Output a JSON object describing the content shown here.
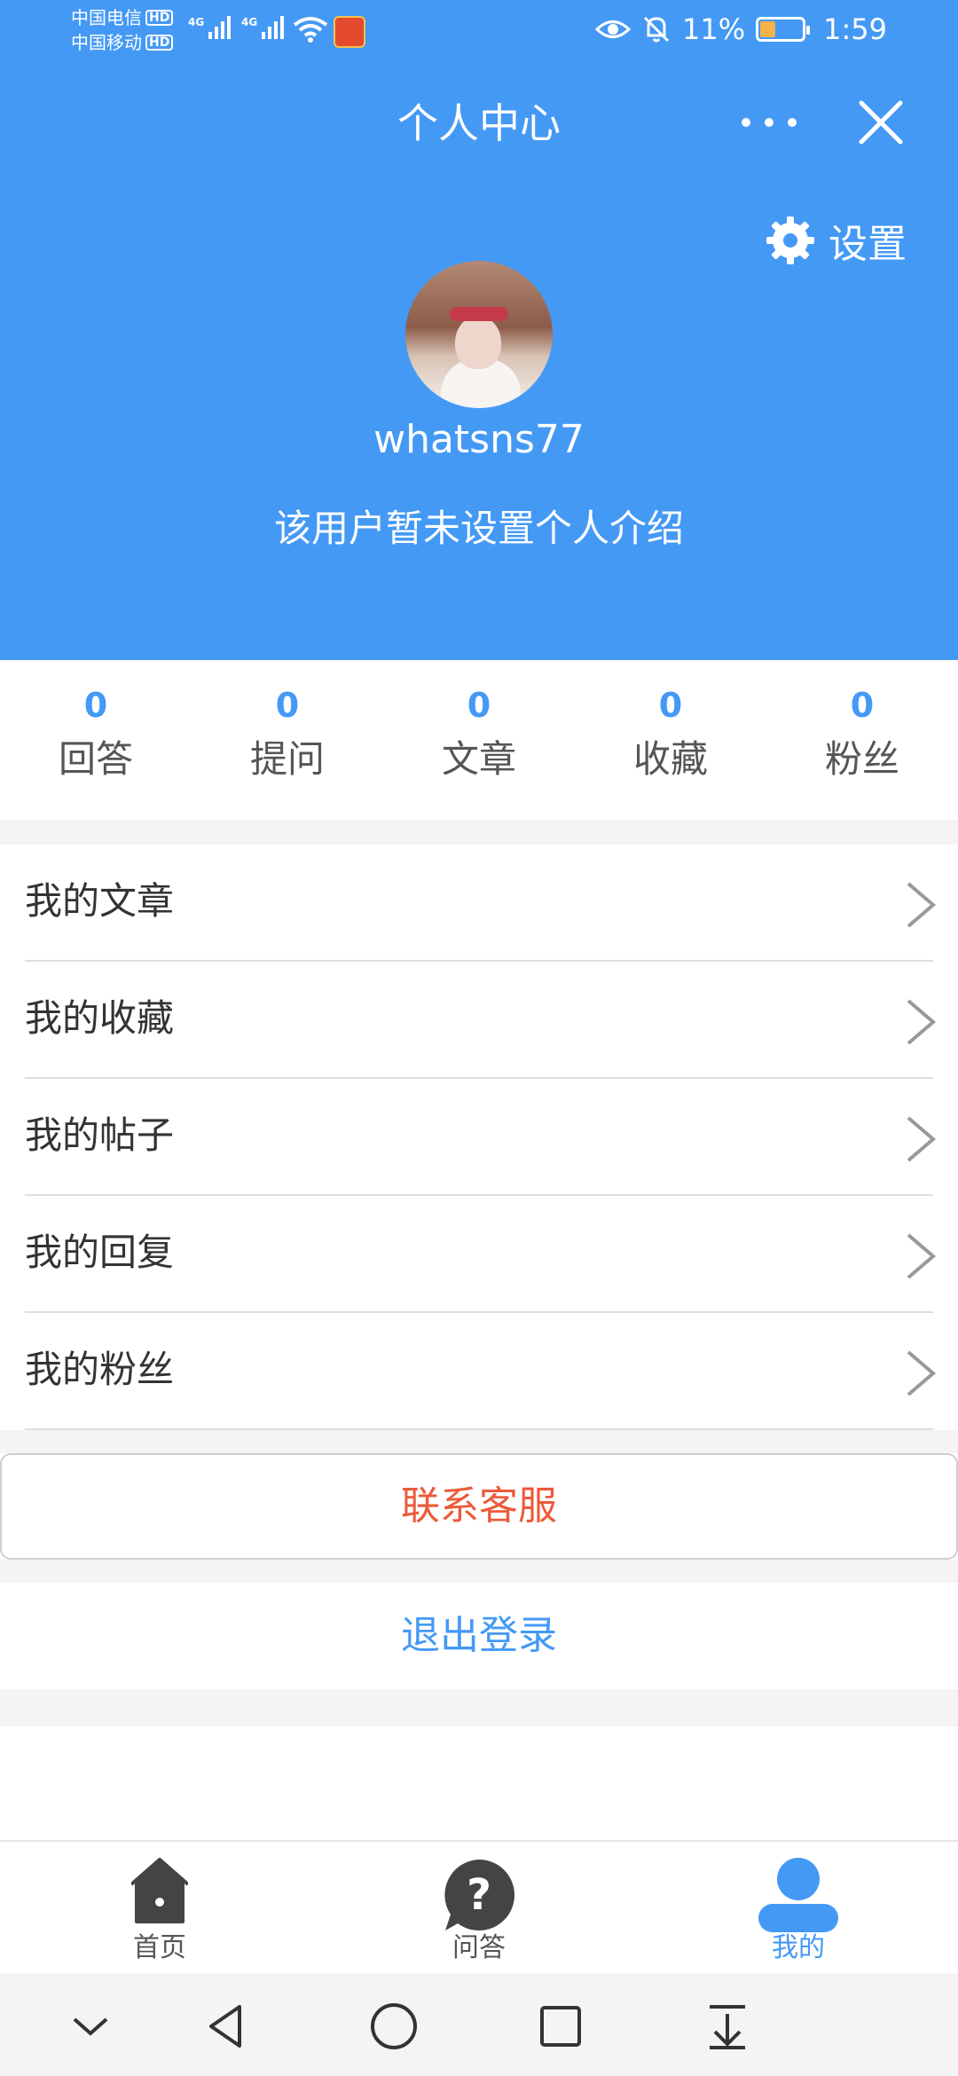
{
  "status_bar": {
    "carrier1": "中国电信",
    "carrier2": "中国移动",
    "hd": "HD",
    "net1": "4G",
    "net2": "4G",
    "battery_percent": "11%",
    "time": "1:59"
  },
  "header": {
    "title": "个人中心",
    "settings_label": "设置",
    "username": "whatsns77",
    "bio": "该用户暂未设置个人介绍"
  },
  "stats": [
    {
      "value": "0",
      "label": "回答"
    },
    {
      "value": "0",
      "label": "提问"
    },
    {
      "value": "0",
      "label": "文章"
    },
    {
      "value": "0",
      "label": "收藏"
    },
    {
      "value": "0",
      "label": "粉丝"
    }
  ],
  "menu": [
    {
      "label": "我的文章"
    },
    {
      "label": "我的收藏"
    },
    {
      "label": "我的帖子"
    },
    {
      "label": "我的回复"
    },
    {
      "label": "我的粉丝"
    }
  ],
  "actions": {
    "contact": "联系客服",
    "logout": "退出登录"
  },
  "tabbar": [
    {
      "label": "首页",
      "icon": "home-icon"
    },
    {
      "label": "问答",
      "icon": "question-icon"
    },
    {
      "label": "我的",
      "icon": "user-icon",
      "active": true
    }
  ],
  "colors": {
    "primary": "#4499f5",
    "contact_text": "#ec5a3a",
    "background_gray": "#f4f4f4"
  }
}
